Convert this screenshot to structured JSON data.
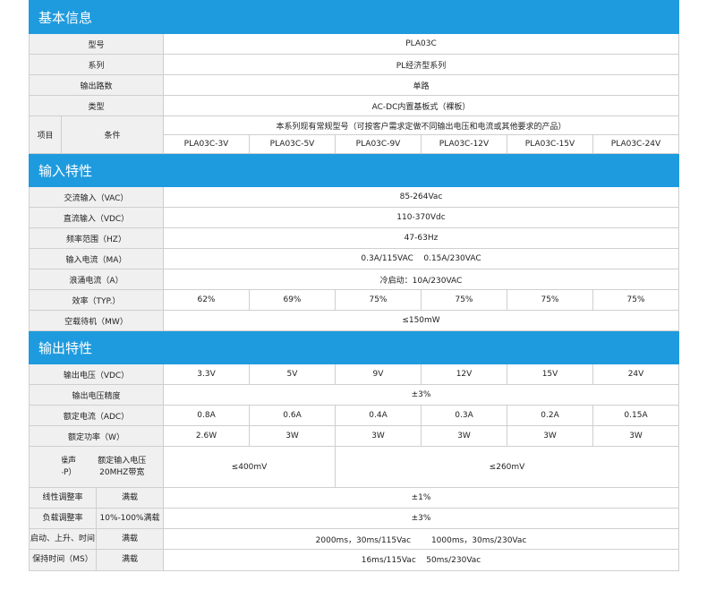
{
  "sections": {
    "basic": "基本信息",
    "input": "输入特性",
    "output": "输出特性"
  },
  "basic": {
    "model_label": "型号",
    "model_value": "PLA03C",
    "series_label": "系列",
    "series_value": "PL经济型系列",
    "outputs_label": "输出路数",
    "outputs_value": "单路",
    "type_label": "类型",
    "type_value": "AC-DC内置基板式（裸板）",
    "item_label": "项目",
    "condition_label": "条件",
    "note": "本系列现有常规型号（可按客户需求定做不同输出电压和电流或其他要求的产品）",
    "models": [
      "PLA03C-3V",
      "PLA03C-5V",
      "PLA03C-9V",
      "PLA03C-12V",
      "PLA03C-15V",
      "PLA03C-24V"
    ]
  },
  "input": {
    "ac_label": "交流输入（VAC）",
    "ac_value": "85-264Vac",
    "dc_label": "直流输入（VDC）",
    "dc_value": "110-370Vdc",
    "freq_label": "频率范围（HZ）",
    "freq_value": "47-63Hz",
    "current_label": "输入电流（MA）",
    "current_value": "0.3A/115VAC    0.15A/230VAC",
    "inrush_label": "浪涌电流（A）",
    "inrush_value": "冷启动：10A/230VAC",
    "eff_label": "效率（TYP.）",
    "eff_values": [
      "62%",
      "69%",
      "75%",
      "75%",
      "75%",
      "75%"
    ],
    "standby_label": "空载待机（MW）",
    "standby_value": "≤150mW"
  },
  "output": {
    "voltage_label": "输出电压（VDC）",
    "voltage_values": [
      "3.3V",
      "5V",
      "9V",
      "12V",
      "15V",
      "24V"
    ],
    "accuracy_label": "输出电压精度",
    "accuracy_value": "±3%",
    "current_label": "额定电流（ADC）",
    "current_values": [
      "0.8A",
      "0.6A",
      "0.4A",
      "0.3A",
      "0.2A",
      "0.15A"
    ],
    "power_label": "额定功率（W）",
    "power_values": [
      "2.6W",
      "3W",
      "3W",
      "3W",
      "3W",
      "3W"
    ],
    "ripple_label_1": "纹波与噪声",
    "ripple_label_2": "（MVP-P）",
    "ripple_cond_1": "额定输入电压",
    "ripple_cond_2": "20MHZ带宽",
    "ripple_value_a": "≤400mV",
    "ripple_value_b": "≤260mV",
    "line_label": "线性调整率",
    "line_cond": "满载",
    "line_value": "±1%",
    "load_label": "负载调整率",
    "load_cond": "10%-100%满载",
    "load_value": "±3%",
    "rise_label": "启动、上升、时间",
    "rise_cond": "满载",
    "rise_value": "2000ms，30ms/115Vac        1000ms，30ms/230Vac",
    "hold_label": "保持时间（MS）",
    "hold_cond": "满载",
    "hold_value": "16ms/115Vac    50ms/230Vac"
  }
}
